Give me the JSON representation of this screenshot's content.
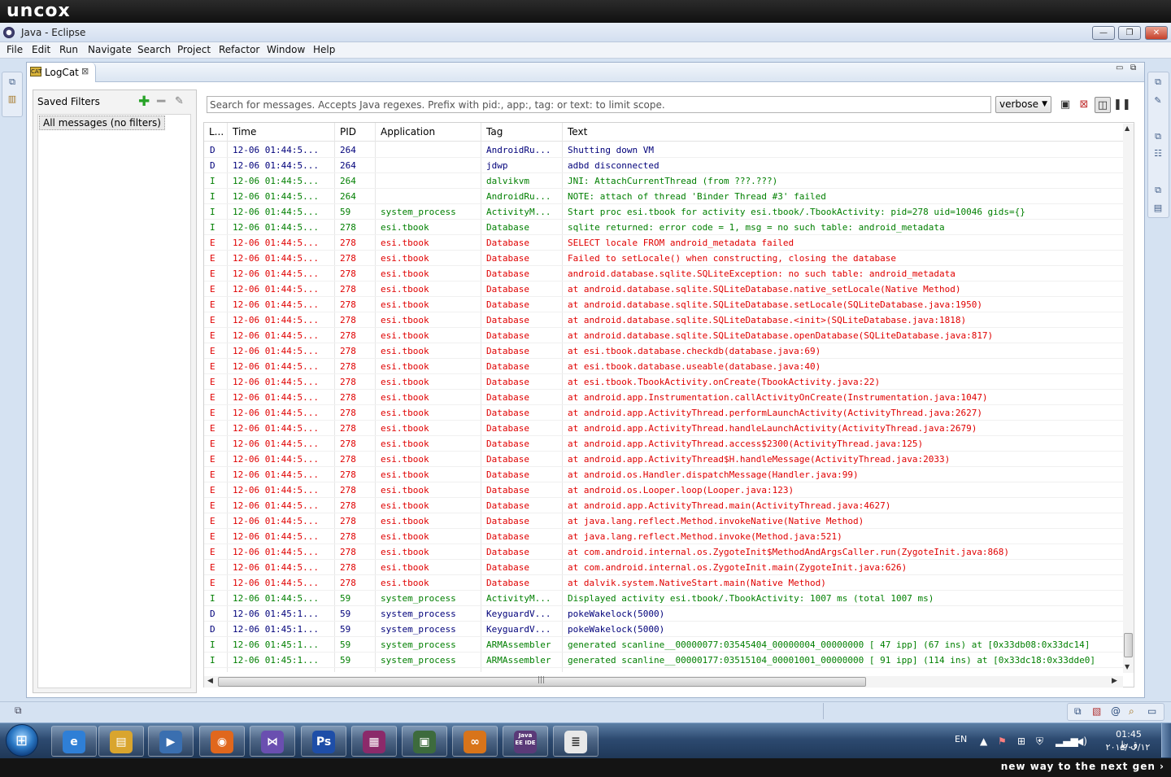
{
  "brand": {
    "logo_text": "uncox",
    "tagline": "new way to the next gen ›"
  },
  "window": {
    "title": "Java - Eclipse",
    "minimize": "—",
    "restore": "❐",
    "close": "✕"
  },
  "menu": [
    "File",
    "Edit",
    "Run",
    "Navigate",
    "Search",
    "Project",
    "Refactor",
    "Window",
    "Help"
  ],
  "view": {
    "tab_label": "LogCat",
    "tab_icon_text": "CAT"
  },
  "filters": {
    "title": "Saved Filters",
    "items": [
      "All messages (no filters)"
    ]
  },
  "search": {
    "placeholder": "Search for messages. Accepts Java regexes. Prefix with pid:, app:, tag: or text: to limit scope.",
    "level": "verbose"
  },
  "table": {
    "columns": [
      "L...",
      "Time",
      "PID",
      "Application",
      "Tag",
      "Text"
    ],
    "rows": [
      {
        "level": "D",
        "time": "12-06 01:44:5...",
        "pid": "264",
        "app": "",
        "tag": "AndroidRu...",
        "text": "Shutting down VM"
      },
      {
        "level": "D",
        "time": "12-06 01:44:5...",
        "pid": "264",
        "app": "",
        "tag": "jdwp",
        "text": "adbd disconnected"
      },
      {
        "level": "I",
        "time": "12-06 01:44:5...",
        "pid": "264",
        "app": "",
        "tag": "dalvikvm",
        "text": "JNI: AttachCurrentThread (from ???.???)"
      },
      {
        "level": "I",
        "time": "12-06 01:44:5...",
        "pid": "264",
        "app": "",
        "tag": "AndroidRu...",
        "text": "NOTE: attach of thread 'Binder Thread #3' failed"
      },
      {
        "level": "I",
        "time": "12-06 01:44:5...",
        "pid": "59",
        "app": "system_process",
        "tag": "ActivityM...",
        "text": "Start proc esi.tbook for activity esi.tbook/.TbookActivity: pid=278 uid=10046 gids={}"
      },
      {
        "level": "I",
        "time": "12-06 01:44:5...",
        "pid": "278",
        "app": "esi.tbook",
        "tag": "Database",
        "text": "sqlite returned: error code = 1, msg = no such table: android_metadata"
      },
      {
        "level": "E",
        "time": "12-06 01:44:5...",
        "pid": "278",
        "app": "esi.tbook",
        "tag": "Database",
        "text": "SELECT locale FROM android_metadata failed"
      },
      {
        "level": "E",
        "time": "12-06 01:44:5...",
        "pid": "278",
        "app": "esi.tbook",
        "tag": "Database",
        "text": "Failed to setLocale() when constructing, closing the database"
      },
      {
        "level": "E",
        "time": "12-06 01:44:5...",
        "pid": "278",
        "app": "esi.tbook",
        "tag": "Database",
        "text": "android.database.sqlite.SQLiteException: no such table: android_metadata"
      },
      {
        "level": "E",
        "time": "12-06 01:44:5...",
        "pid": "278",
        "app": "esi.tbook",
        "tag": "Database",
        "text": "at android.database.sqlite.SQLiteDatabase.native_setLocale(Native Method)"
      },
      {
        "level": "E",
        "time": "12-06 01:44:5...",
        "pid": "278",
        "app": "esi.tbook",
        "tag": "Database",
        "text": "at android.database.sqlite.SQLiteDatabase.setLocale(SQLiteDatabase.java:1950)"
      },
      {
        "level": "E",
        "time": "12-06 01:44:5...",
        "pid": "278",
        "app": "esi.tbook",
        "tag": "Database",
        "text": "at android.database.sqlite.SQLiteDatabase.<init>(SQLiteDatabase.java:1818)"
      },
      {
        "level": "E",
        "time": "12-06 01:44:5...",
        "pid": "278",
        "app": "esi.tbook",
        "tag": "Database",
        "text": "at android.database.sqlite.SQLiteDatabase.openDatabase(SQLiteDatabase.java:817)"
      },
      {
        "level": "E",
        "time": "12-06 01:44:5...",
        "pid": "278",
        "app": "esi.tbook",
        "tag": "Database",
        "text": "at esi.tbook.database.checkdb(database.java:69)"
      },
      {
        "level": "E",
        "time": "12-06 01:44:5...",
        "pid": "278",
        "app": "esi.tbook",
        "tag": "Database",
        "text": "at esi.tbook.database.useable(database.java:40)"
      },
      {
        "level": "E",
        "time": "12-06 01:44:5...",
        "pid": "278",
        "app": "esi.tbook",
        "tag": "Database",
        "text": "at esi.tbook.TbookActivity.onCreate(TbookActivity.java:22)"
      },
      {
        "level": "E",
        "time": "12-06 01:44:5...",
        "pid": "278",
        "app": "esi.tbook",
        "tag": "Database",
        "text": "at android.app.Instrumentation.callActivityOnCreate(Instrumentation.java:1047)"
      },
      {
        "level": "E",
        "time": "12-06 01:44:5...",
        "pid": "278",
        "app": "esi.tbook",
        "tag": "Database",
        "text": "at android.app.ActivityThread.performLaunchActivity(ActivityThread.java:2627)"
      },
      {
        "level": "E",
        "time": "12-06 01:44:5...",
        "pid": "278",
        "app": "esi.tbook",
        "tag": "Database",
        "text": "at android.app.ActivityThread.handleLaunchActivity(ActivityThread.java:2679)"
      },
      {
        "level": "E",
        "time": "12-06 01:44:5...",
        "pid": "278",
        "app": "esi.tbook",
        "tag": "Database",
        "text": "at android.app.ActivityThread.access$2300(ActivityThread.java:125)"
      },
      {
        "level": "E",
        "time": "12-06 01:44:5...",
        "pid": "278",
        "app": "esi.tbook",
        "tag": "Database",
        "text": "at android.app.ActivityThread$H.handleMessage(ActivityThread.java:2033)"
      },
      {
        "level": "E",
        "time": "12-06 01:44:5...",
        "pid": "278",
        "app": "esi.tbook",
        "tag": "Database",
        "text": "at android.os.Handler.dispatchMessage(Handler.java:99)"
      },
      {
        "level": "E",
        "time": "12-06 01:44:5...",
        "pid": "278",
        "app": "esi.tbook",
        "tag": "Database",
        "text": "at android.os.Looper.loop(Looper.java:123)"
      },
      {
        "level": "E",
        "time": "12-06 01:44:5...",
        "pid": "278",
        "app": "esi.tbook",
        "tag": "Database",
        "text": "at android.app.ActivityThread.main(ActivityThread.java:4627)"
      },
      {
        "level": "E",
        "time": "12-06 01:44:5...",
        "pid": "278",
        "app": "esi.tbook",
        "tag": "Database",
        "text": "at java.lang.reflect.Method.invokeNative(Native Method)"
      },
      {
        "level": "E",
        "time": "12-06 01:44:5...",
        "pid": "278",
        "app": "esi.tbook",
        "tag": "Database",
        "text": "at java.lang.reflect.Method.invoke(Method.java:521)"
      },
      {
        "level": "E",
        "time": "12-06 01:44:5...",
        "pid": "278",
        "app": "esi.tbook",
        "tag": "Database",
        "text": "at com.android.internal.os.ZygoteInit$MethodAndArgsCaller.run(ZygoteInit.java:868)"
      },
      {
        "level": "E",
        "time": "12-06 01:44:5...",
        "pid": "278",
        "app": "esi.tbook",
        "tag": "Database",
        "text": "at com.android.internal.os.ZygoteInit.main(ZygoteInit.java:626)"
      },
      {
        "level": "E",
        "time": "12-06 01:44:5...",
        "pid": "278",
        "app": "esi.tbook",
        "tag": "Database",
        "text": "at dalvik.system.NativeStart.main(Native Method)"
      },
      {
        "level": "I",
        "time": "12-06 01:44:5...",
        "pid": "59",
        "app": "system_process",
        "tag": "ActivityM...",
        "text": "Displayed activity esi.tbook/.TbookActivity: 1007 ms (total 1007 ms)"
      },
      {
        "level": "D",
        "time": "12-06 01:45:1...",
        "pid": "59",
        "app": "system_process",
        "tag": "KeyguardV...",
        "text": "pokeWakelock(5000)"
      },
      {
        "level": "D",
        "time": "12-06 01:45:1...",
        "pid": "59",
        "app": "system_process",
        "tag": "KeyguardV...",
        "text": "pokeWakelock(5000)"
      },
      {
        "level": "I",
        "time": "12-06 01:45:1...",
        "pid": "59",
        "app": "system_process",
        "tag": "ARMAssembler",
        "text": "generated scanline__00000077:03545404_00000004_00000000 [ 47 ipp] (67 ins) at [0x33db08:0x33dc14]"
      },
      {
        "level": "I",
        "time": "12-06 01:45:1...",
        "pid": "59",
        "app": "system_process",
        "tag": "ARMAssembler",
        "text": "generated scanline__00000177:03515104_00001001_00000000 [ 91 ipp] (114 ins) at [0x33dc18:0x33dde0]"
      }
    ]
  },
  "taskbar": {
    "apps": [
      {
        "name": "internet-explorer",
        "glyph": "e"
      },
      {
        "name": "file-explorer",
        "glyph": "▤"
      },
      {
        "name": "media-player",
        "glyph": "▶"
      },
      {
        "name": "firefox",
        "glyph": "◉"
      },
      {
        "name": "visual-studio",
        "glyph": "⋈"
      },
      {
        "name": "photoshop",
        "glyph": "Ps"
      },
      {
        "name": "winrar",
        "glyph": "▦"
      },
      {
        "name": "monitor",
        "glyph": "▣"
      },
      {
        "name": "link-app",
        "glyph": "∞"
      },
      {
        "name": "eclipse-javaee",
        "glyph": "Java EE IDE"
      },
      {
        "name": "notepad",
        "glyph": "≣"
      }
    ],
    "lang": "EN",
    "time": "01:45 ق.ظ",
    "date": "۲۰۱۵/۰۶/۱۲"
  },
  "colors": {
    "debug": "#00007a",
    "info": "#007f00",
    "error": "#e00000",
    "accent": "#3e5a85"
  }
}
